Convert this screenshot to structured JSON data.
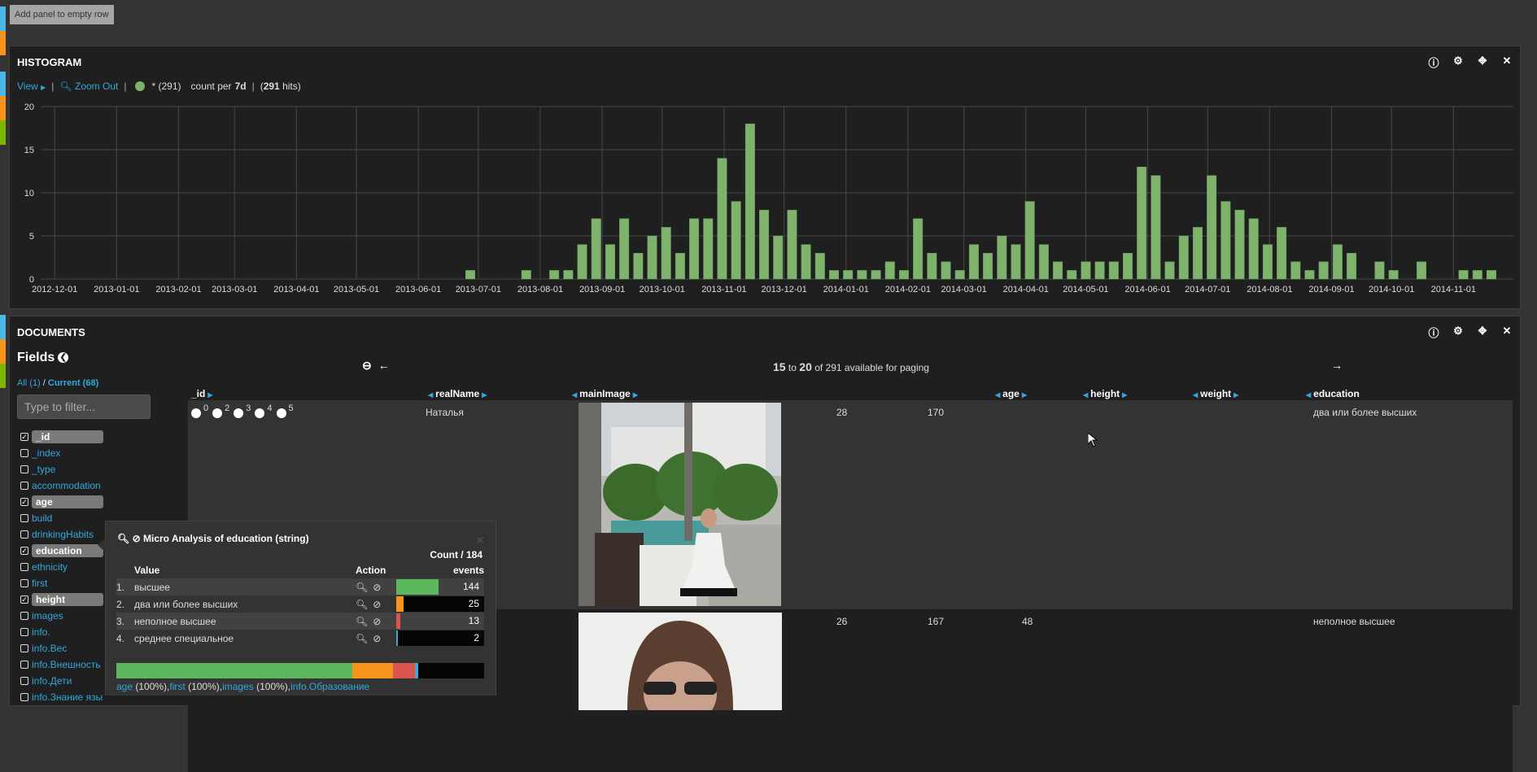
{
  "colors": {
    "accent": "#33a8dc",
    "bar": "#7eb26d",
    "stripe_blue": "#4ab8e8",
    "stripe_orange": "#f7941d",
    "stripe_green": "#7cb800"
  },
  "toolbar": {
    "add_panel_label": "Add panel to empty row"
  },
  "histogram": {
    "title": "HISTOGRAM",
    "view_label": "View",
    "zoom_out_label": "Zoom Out",
    "legend_label": "* (291)",
    "count_prefix": "count per",
    "interval": "7d",
    "hits_open": "(",
    "hits": "291",
    "hits_suffix": "hits)",
    "icons": [
      "info-icon",
      "gear-icon",
      "move-icon",
      "close-icon"
    ]
  },
  "chart_data": {
    "type": "bar",
    "title": "HISTOGRAM",
    "xlabel": "",
    "ylabel": "count per 7d",
    "ylim": [
      0,
      20
    ],
    "yticks": [
      0,
      5,
      10,
      15,
      20
    ],
    "xlim": [
      "2012-11-24",
      "2014-12-01"
    ],
    "xticks": [
      "2012-12-01",
      "2013-01-01",
      "2013-02-01",
      "2013-03-01",
      "2013-04-01",
      "2013-05-01",
      "2013-06-01",
      "2013-07-01",
      "2013-08-01",
      "2013-09-01",
      "2013-10-01",
      "2013-11-01",
      "2013-12-01",
      "2014-01-01",
      "2014-02-01",
      "2014-03-01",
      "2014-04-01",
      "2014-05-01",
      "2014-06-01",
      "2014-07-01",
      "2014-08-01",
      "2014-09-01",
      "2014-10-01",
      "2014-11-01"
    ],
    "grid": true,
    "series": [
      {
        "name": "* (291)",
        "color": "#7eb26d",
        "points": [
          [
            "2013-06-27",
            1
          ],
          [
            "2013-07-25",
            1
          ],
          [
            "2013-08-08",
            1
          ],
          [
            "2013-08-15",
            1
          ],
          [
            "2013-08-22",
            4
          ],
          [
            "2013-08-29",
            7
          ],
          [
            "2013-09-05",
            4
          ],
          [
            "2013-09-12",
            7
          ],
          [
            "2013-09-19",
            3
          ],
          [
            "2013-09-26",
            5
          ],
          [
            "2013-10-03",
            6
          ],
          [
            "2013-10-10",
            3
          ],
          [
            "2013-10-17",
            7
          ],
          [
            "2013-10-24",
            7
          ],
          [
            "2013-10-31",
            14
          ],
          [
            "2013-11-07",
            9
          ],
          [
            "2013-11-14",
            18
          ],
          [
            "2013-11-21",
            8
          ],
          [
            "2013-11-28",
            5
          ],
          [
            "2013-12-05",
            8
          ],
          [
            "2013-12-12",
            4
          ],
          [
            "2013-12-19",
            3
          ],
          [
            "2013-12-26",
            1
          ],
          [
            "2014-01-02",
            1
          ],
          [
            "2014-01-09",
            1
          ],
          [
            "2014-01-16",
            1
          ],
          [
            "2014-01-23",
            2
          ],
          [
            "2014-01-30",
            1
          ],
          [
            "2014-02-06",
            7
          ],
          [
            "2014-02-13",
            3
          ],
          [
            "2014-02-20",
            2
          ],
          [
            "2014-02-27",
            1
          ],
          [
            "2014-03-06",
            4
          ],
          [
            "2014-03-13",
            3
          ],
          [
            "2014-03-20",
            5
          ],
          [
            "2014-03-27",
            4
          ],
          [
            "2014-04-03",
            9
          ],
          [
            "2014-04-10",
            4
          ],
          [
            "2014-04-17",
            2
          ],
          [
            "2014-04-24",
            1
          ],
          [
            "2014-05-01",
            2
          ],
          [
            "2014-05-08",
            2
          ],
          [
            "2014-05-15",
            2
          ],
          [
            "2014-05-22",
            3
          ],
          [
            "2014-05-29",
            13
          ],
          [
            "2014-06-05",
            12
          ],
          [
            "2014-06-12",
            2
          ],
          [
            "2014-06-19",
            5
          ],
          [
            "2014-06-26",
            6
          ],
          [
            "2014-07-03",
            12
          ],
          [
            "2014-07-10",
            9
          ],
          [
            "2014-07-17",
            8
          ],
          [
            "2014-07-24",
            7
          ],
          [
            "2014-07-31",
            4
          ],
          [
            "2014-08-07",
            6
          ],
          [
            "2014-08-14",
            2
          ],
          [
            "2014-08-21",
            1
          ],
          [
            "2014-08-28",
            2
          ],
          [
            "2014-09-04",
            4
          ],
          [
            "2014-09-11",
            3
          ],
          [
            "2014-09-25",
            2
          ],
          [
            "2014-10-02",
            1
          ],
          [
            "2014-10-16",
            2
          ],
          [
            "2014-11-06",
            1
          ],
          [
            "2014-11-13",
            1
          ],
          [
            "2014-11-20",
            1
          ]
        ]
      }
    ]
  },
  "documents": {
    "title": "DOCUMENTS",
    "fields_label": "Fields",
    "scope_all": "All (1)",
    "scope_sep": " / ",
    "scope_current": "Current (68)",
    "filter_placeholder": "Type to filter...",
    "fields": [
      {
        "name": "_id",
        "checked": true
      },
      {
        "name": "_index",
        "checked": false
      },
      {
        "name": "_type",
        "checked": false
      },
      {
        "name": "accommodation",
        "checked": false
      },
      {
        "name": "age",
        "checked": true
      },
      {
        "name": "build",
        "checked": false
      },
      {
        "name": "drinkingHabits",
        "checked": false
      },
      {
        "name": "education",
        "checked": true
      },
      {
        "name": "ethnicity",
        "checked": false
      },
      {
        "name": "first",
        "checked": false
      },
      {
        "name": "height",
        "checked": true
      },
      {
        "name": "images",
        "checked": false
      },
      {
        "name": "info.",
        "checked": false
      },
      {
        "name": "info.Вес",
        "checked": false
      },
      {
        "name": "info.Внешность",
        "checked": false
      },
      {
        "name": "info.Дети",
        "checked": false
      },
      {
        "name": "info.Знание язы",
        "checked": false
      }
    ],
    "pager": {
      "from": "15",
      "to_word": "to",
      "to": "20",
      "rest": "of 291 available for paging"
    },
    "columns": [
      "_id",
      "realName",
      "mainImage",
      "age",
      "height",
      "weight",
      "education"
    ],
    "rows": [
      {
        "id_options": [
          "0",
          "2",
          "3",
          "4",
          "5"
        ],
        "realName": "Наталья",
        "mainImage": "photo-pool",
        "age": "28",
        "height": "170",
        "weight": "",
        "education": "два или более высших"
      },
      {
        "id_options": [],
        "realName": "",
        "mainImage": "photo-sunglasses",
        "age": "26",
        "height": "167",
        "weight": "48",
        "education": "неполное высшее"
      }
    ]
  },
  "micro_analysis": {
    "title": "Micro Analysis of education (string)",
    "count_label": "Count / 184",
    "col_value": "Value",
    "col_action": "Action",
    "col_events": "events",
    "total": 184,
    "rows": [
      {
        "rank": "1.",
        "value": "высшее",
        "count": 144,
        "color": "#5cb85c"
      },
      {
        "rank": "2.",
        "value": "два или более высших",
        "count": 25,
        "color": "#f7941d"
      },
      {
        "rank": "3.",
        "value": "неполное высшее",
        "count": 13,
        "color": "#d9534f"
      },
      {
        "rank": "4.",
        "value": "среднее специальное",
        "count": 2,
        "color": "#3fa9d5"
      }
    ],
    "footer_links": [
      {
        "name": "age",
        "pct": " (100%),"
      },
      {
        "name": "first",
        "pct": " (100%),"
      },
      {
        "name": "images",
        "pct": " (100%),"
      },
      {
        "name": "info.Образование",
        "pct": ""
      }
    ]
  }
}
